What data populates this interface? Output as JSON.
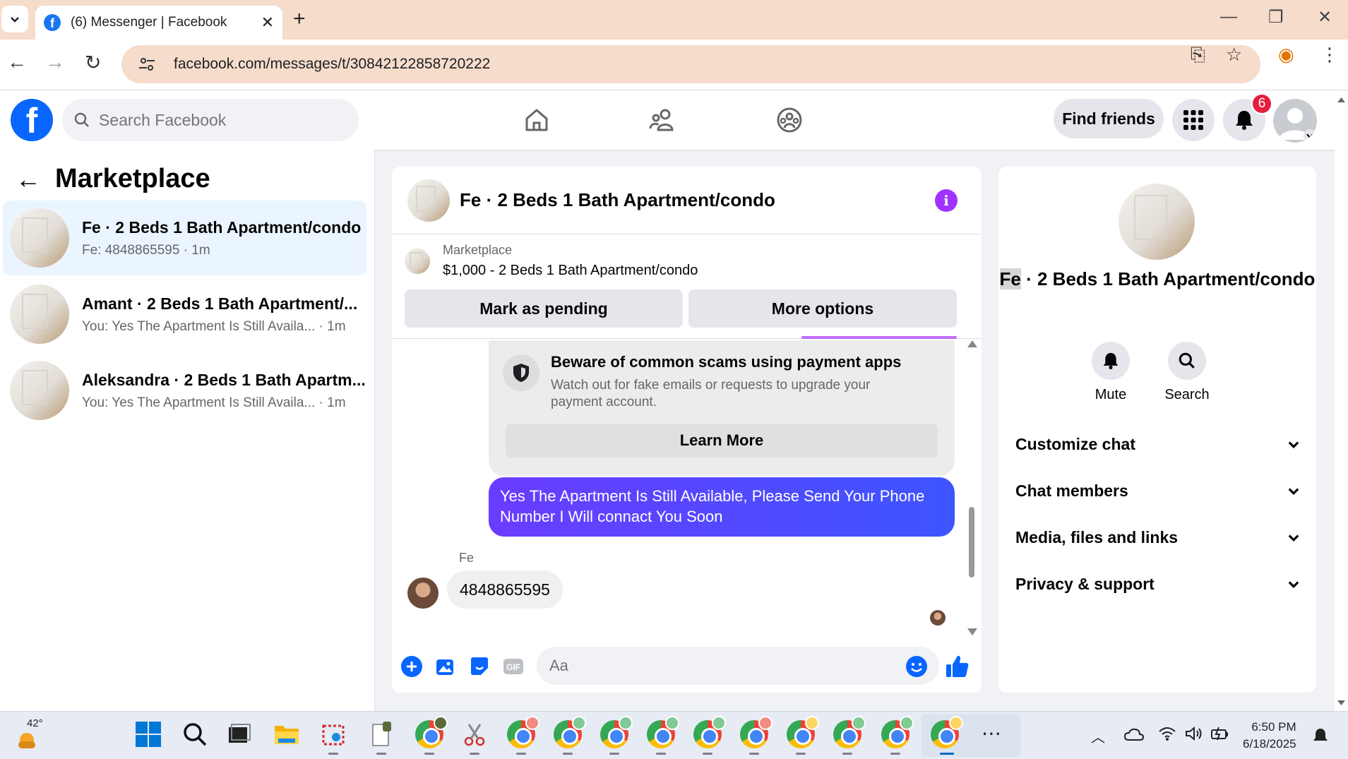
{
  "browser": {
    "tab_title": "(6) Messenger | Facebook",
    "url": "facebook.com/messages/t/30842122858720222"
  },
  "header": {
    "search_placeholder": "Search Facebook",
    "find_friends": "Find friends",
    "notification_count": "6",
    "accent": "#0866ff"
  },
  "left_panel": {
    "title": "Marketplace",
    "conversations": [
      {
        "name": "Fe · 2 Beds 1 Bath Apartment/condo",
        "preview": "Fe: 4848865595 · 1m",
        "active": true
      },
      {
        "name": "Amant · 2 Beds 1 Bath Apartment/...",
        "preview": "You: Yes The Apartment Is Still Availa... · 1m",
        "active": false
      },
      {
        "name": "Aleksandra · 2 Beds 1 Bath Apartm...",
        "preview": "You: Yes The Apartment Is Still Availa... · 1m",
        "active": false
      }
    ]
  },
  "chat": {
    "title": "Fe · 2 Beds 1 Bath Apartment/condo",
    "marketplace_label": "Marketplace",
    "listing": "$1,000 - 2 Beds 1 Bath Apartment/condo",
    "mark_pending": "Mark as pending",
    "more_options": "More options",
    "scam_title": "Beware of common scams using payment apps",
    "scam_desc": "Watch out for fake emails or requests to upgrade your payment account.",
    "learn_more": "Learn More",
    "outgoing_message": "Yes The Apartment Is Still Available, Please Send Your Phone Number I Will connact You Soon",
    "sender_name": "Fe",
    "incoming_message": "4848865595",
    "input_placeholder": "Aa",
    "outgoing_color": "#4d46ff"
  },
  "right_panel": {
    "title_highlight": "Fe",
    "title_rest": " · 2 Beds 1 Bath Apartment/condo",
    "mute": "Mute",
    "search": "Search",
    "sections": [
      "Customize chat",
      "Chat members",
      "Media, files and links",
      "Privacy & support"
    ]
  },
  "taskbar": {
    "temperature": "42°",
    "time": "6:50 PM",
    "date": "6/18/2025"
  }
}
